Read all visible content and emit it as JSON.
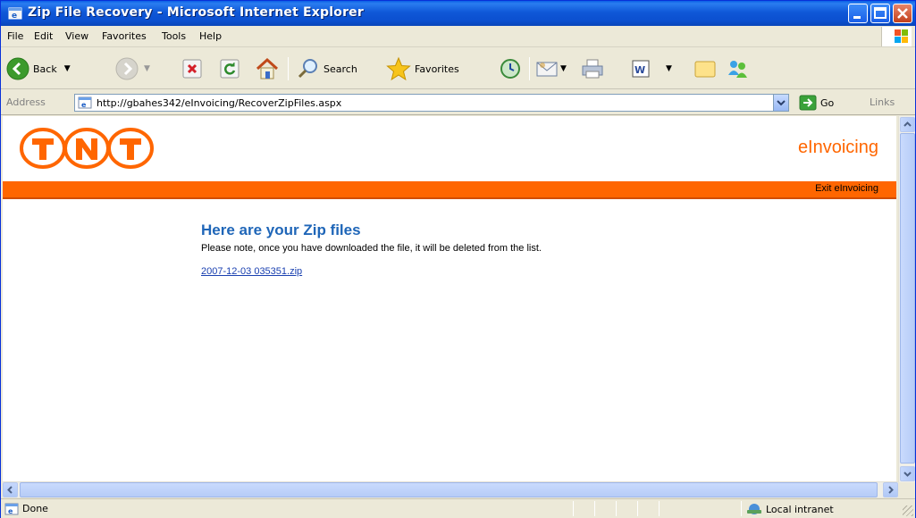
{
  "window": {
    "title": "Zip File Recovery - Microsoft Internet Explorer"
  },
  "menubar": {
    "items": [
      "File",
      "Edit",
      "View",
      "Favorites",
      "Tools",
      "Help"
    ]
  },
  "toolbar": {
    "back_label": "Back",
    "search_label": "Search",
    "favorites_label": "Favorites"
  },
  "addressbar": {
    "label": "Address",
    "url": "http://gbahes342/eInvoicing/RecoverZipFiles.aspx",
    "go_label": "Go",
    "links_label": "Links"
  },
  "page": {
    "brand": "eInvoicing",
    "exit_link": "Exit eInvoicing",
    "heading": "Here are your Zip files",
    "note": "Please note, once you have downloaded the file, it will be deleted from the list.",
    "files": [
      "2007-12-03 035351.zip"
    ]
  },
  "statusbar": {
    "status": "Done",
    "zone": "Local intranet"
  },
  "colors": {
    "accent_orange": "#ff6600",
    "heading_blue": "#1f66b8",
    "titlebar_blue": "#0b4fcf"
  }
}
